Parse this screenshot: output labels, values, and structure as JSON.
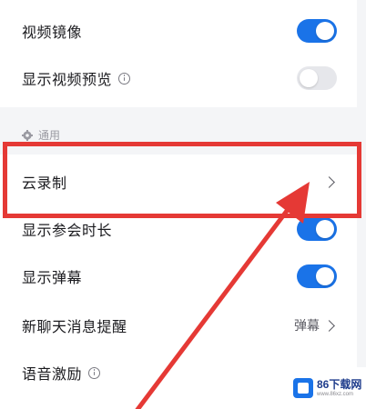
{
  "settings_top": {
    "rows": [
      {
        "label": "视频镜像",
        "toggle_on": true
      },
      {
        "label": "显示视频预览",
        "has_info_icon": true,
        "toggle_on": false
      }
    ]
  },
  "section_general": {
    "title": "通用",
    "icon": "gear-icon"
  },
  "settings_general": {
    "cloud_recording": {
      "label": "云录制",
      "icon": "chevron-right-icon"
    },
    "show_meeting_duration": {
      "label": "显示参会时长",
      "toggle_on": true
    },
    "show_danmaku": {
      "label": "显示弹幕",
      "toggle_on": true
    },
    "new_chat_reminder": {
      "label": "新聊天消息提醒",
      "value": "弹幕",
      "icon": "chevron-right-icon"
    },
    "voice_motivation": {
      "label": "语音激励",
      "has_info_icon": true
    }
  },
  "annotation": {
    "color": "#e53935"
  },
  "colors": {
    "accent": "#1a73e8",
    "toggle_off": "#e6e7eb",
    "background": "#f4f5f7"
  },
  "watermark": {
    "text": "86下载网",
    "subtext": "www.86xz.com"
  }
}
